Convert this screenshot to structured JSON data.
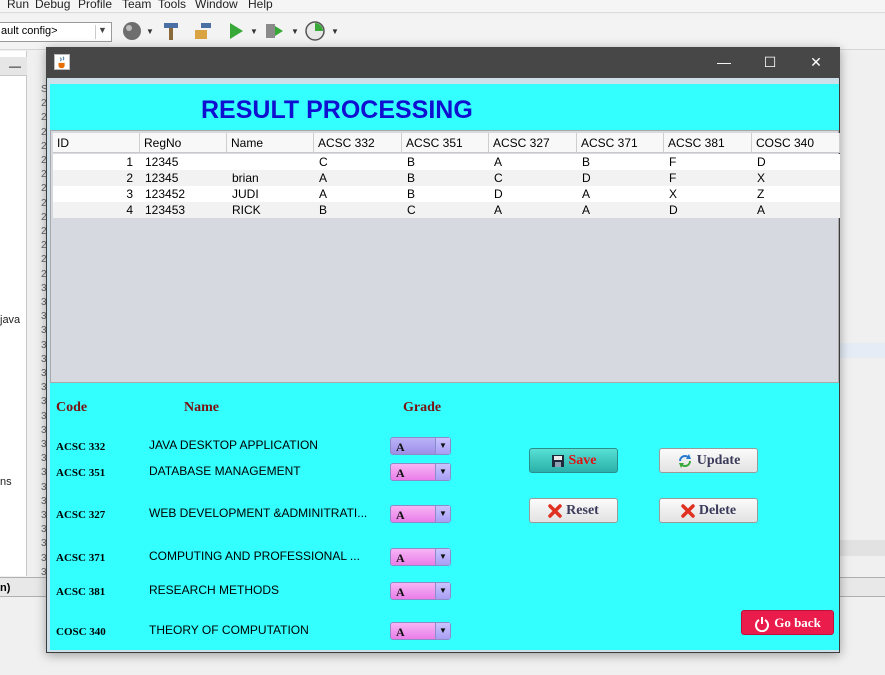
{
  "ide": {
    "menu": [
      "Run",
      "Debug",
      "Profile",
      "Team",
      "Tools",
      "Window",
      "Help"
    ],
    "config_select": "ault config>",
    "left_labels": {
      "java": "java",
      "ns": "ns"
    },
    "gutter_digits": [
      "S",
      "2",
      "2",
      "2",
      "2",
      "2",
      "2",
      "2",
      "2",
      "2",
      "2",
      "2",
      "2",
      "2",
      "3",
      "3",
      "3",
      "3",
      "3",
      "3",
      "3",
      "3",
      "3",
      "3",
      "3",
      "3",
      "3",
      "3",
      "3",
      "3",
      "3",
      "3",
      "3",
      "3",
      "3"
    ],
    "bottom_label": "n)"
  },
  "window": {
    "controls": {
      "minimize": "—",
      "maximize": "☐",
      "close": "✕"
    }
  },
  "page": {
    "title": "RESULT PROCESSING"
  },
  "table": {
    "columns": [
      "ID",
      "RegNo",
      "Name",
      "ACSC 332",
      "ACSC 351",
      "ACSC 327",
      "ACSC 371",
      "ACSC 381",
      "COSC 340"
    ],
    "rows": [
      [
        "1",
        "12345",
        "",
        "C",
        "B",
        "A",
        "B",
        "F",
        "D"
      ],
      [
        "2",
        "12345",
        "brian",
        "A",
        "B",
        "C",
        "D",
        "F",
        "X"
      ],
      [
        "3",
        "123452",
        "JUDI",
        "A",
        "B",
        "D",
        "A",
        "X",
        "Z"
      ],
      [
        "4",
        "123453",
        "RICK",
        "B",
        "C",
        "A",
        "A",
        "D",
        "A"
      ]
    ]
  },
  "form": {
    "headers": {
      "code": "Code",
      "name": "Name",
      "grade": "Grade"
    },
    "courses": [
      {
        "code": "ACSC 332",
        "name": "JAVA DESKTOP APPLICATION",
        "grade": "A"
      },
      {
        "code": "ACSC 351",
        "name": "DATABASE MANAGEMENT",
        "grade": "A"
      },
      {
        "code": "ACSC 327",
        "name": "WEB DEVELOPMENT &ADMINITRATI...",
        "grade": "A"
      },
      {
        "code": "ACSC 371",
        "name": "COMPUTING AND PROFESSIONAL ...",
        "grade": "A"
      },
      {
        "code": "ACSC 381",
        "name": "RESEARCH METHODS",
        "grade": "A"
      },
      {
        "code": "COSC 340",
        "name": "THEORY OF COMPUTATION",
        "grade": "A"
      }
    ]
  },
  "buttons": {
    "save": "Save",
    "update": "Update",
    "reset": "Reset",
    "delete": "Delete",
    "go_back": "Go back"
  },
  "colors": {
    "panel": "#33ffff",
    "title": "#1010d0",
    "header_text": "#7a1010",
    "go_back": "#ea1c4c"
  }
}
